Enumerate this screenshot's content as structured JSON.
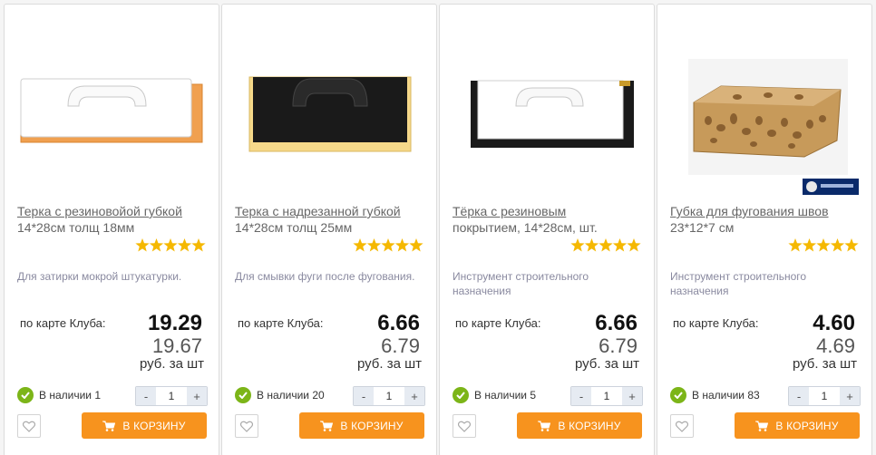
{
  "products": [
    {
      "title_link": "Терка с резиновойой губкой",
      "title_rest": "14*28см толщ 18мм",
      "rating": 5,
      "description": "Для затирки мокрой штукатурки.",
      "club_label": "по карте Клуба:",
      "price_club": "19.29",
      "price_regular": "19.67",
      "unit": "руб. за шт",
      "availability": "В наличии 1",
      "quantity": "1",
      "minus": "-",
      "plus": "+",
      "cart_label": "В КОРЗИНУ"
    },
    {
      "title_link": "Терка с надрезанной губкой",
      "title_rest": "14*28см толщ 25мм",
      "rating": 5,
      "description": "Для смывки фуги после фугования.",
      "club_label": "по карте Клуба:",
      "price_club": "6.66",
      "price_regular": "6.79",
      "unit": "руб. за шт",
      "availability": "В наличии 20",
      "quantity": "1",
      "minus": "-",
      "plus": "+",
      "cart_label": "В КОРЗИНУ"
    },
    {
      "title_link": "Тёрка с резиновым",
      "title_rest": "покрытием, 14*28см, шт.",
      "rating": 5,
      "description": "Инструмент строительного назначения",
      "club_label": "по карте Клуба:",
      "price_club": "6.66",
      "price_regular": "6.79",
      "unit": "руб. за шт",
      "availability": "В наличии 5",
      "quantity": "1",
      "minus": "-",
      "plus": "+",
      "cart_label": "В КОРЗИНУ"
    },
    {
      "title_link": "Губка для фугования швов",
      "title_rest": "23*12*7 см",
      "rating": 5,
      "description": "Инструмент строительного назначения",
      "club_label": "по карте Клуба:",
      "price_club": "4.60",
      "price_regular": "4.69",
      "unit": "руб. за шт",
      "availability": "В наличии 83",
      "quantity": "1",
      "minus": "-",
      "plus": "+",
      "cart_label": "В КОРЗИНУ"
    }
  ],
  "colors": {
    "cart_button": "#f7931e",
    "in_stock": "#7cb518",
    "star": "#f5b800"
  }
}
